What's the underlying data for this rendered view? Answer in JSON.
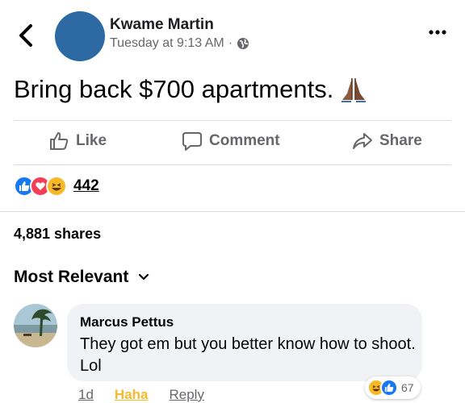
{
  "post": {
    "author": "Kwame Martin",
    "timestamp": "Tuesday at 9:13 AM",
    "separator": "·",
    "privacy_icon": "globe-icon",
    "text": "Bring back $700 apartments.",
    "emoji_icon": "folded-hands-icon"
  },
  "actions": {
    "like_label": "Like",
    "comment_label": "Comment",
    "share_label": "Share"
  },
  "reactions": {
    "icons": [
      "like-icon",
      "love-icon",
      "haha-icon"
    ],
    "count": "442"
  },
  "shares_text": "4,881 shares",
  "sort_label": "Most Relevant",
  "comment": {
    "author": "Marcus Pettus",
    "text": "They got em but you better know how to shoot. Lol",
    "time": "1d",
    "reaction_label": "Haha",
    "reply_label": "Reply",
    "reaction_icons": [
      "haha-icon",
      "like-icon"
    ],
    "reaction_count": "67"
  },
  "colors": {
    "avatar": "#2d6aa3",
    "secondary_text": "#65676b",
    "like_blue": "#1877f2",
    "love_red": "#f33e58",
    "haha_yellow": "#f7b928",
    "bubble_bg": "#f0f2f5"
  }
}
